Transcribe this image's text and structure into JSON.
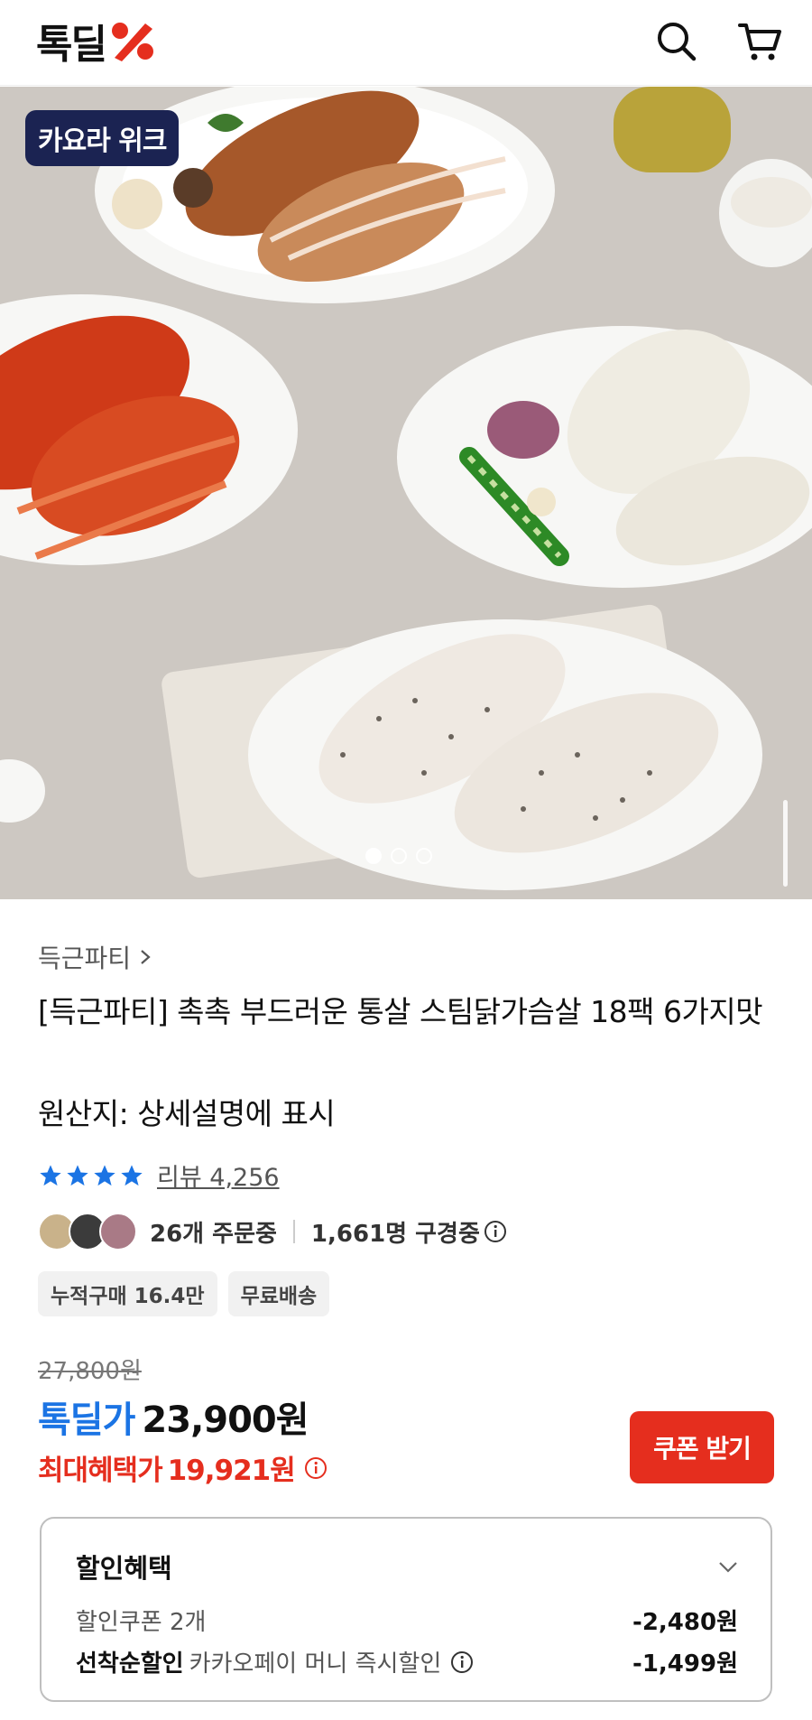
{
  "header": {
    "logo_text": "톡딜",
    "logo_icon": "percent-icon",
    "search_icon": "search-icon",
    "cart_icon": "cart-icon"
  },
  "hero": {
    "badge": "카요라 위크",
    "carousel_dots": 3,
    "active_dot": 1
  },
  "product": {
    "brand": "득근파티",
    "title": "[득근파티] 촉촉 부드러운 통살 스팀닭가슴살 18팩 6가지맛",
    "origin": "원산지: 상세설명에 표시",
    "rating_stars": 4,
    "review_label": "리뷰 4,256",
    "ordering_text": "26개 주문중",
    "watching_text": "1,661명 구경중",
    "chips": [
      "누적구매 16.4만",
      "무료배송"
    ]
  },
  "price": {
    "original": "27,800원",
    "deal_label": "톡딜가",
    "deal_price": "23,900원",
    "max_label": "최대혜택가",
    "max_price": "19,921원",
    "coupon_button": "쿠폰 받기"
  },
  "discount": {
    "title": "할인혜택",
    "rows": [
      {
        "label": "할인쿠폰 2개",
        "bold_label": "",
        "amount": "-2,480원"
      },
      {
        "label": "카카오페이 머니 즉시할인",
        "bold_label": "선착순할인",
        "amount": "-1,499원"
      }
    ]
  },
  "colors": {
    "accent_blue": "#1b74e4",
    "accent_red": "#e52e1e",
    "badge_bg": "#1b2352"
  }
}
